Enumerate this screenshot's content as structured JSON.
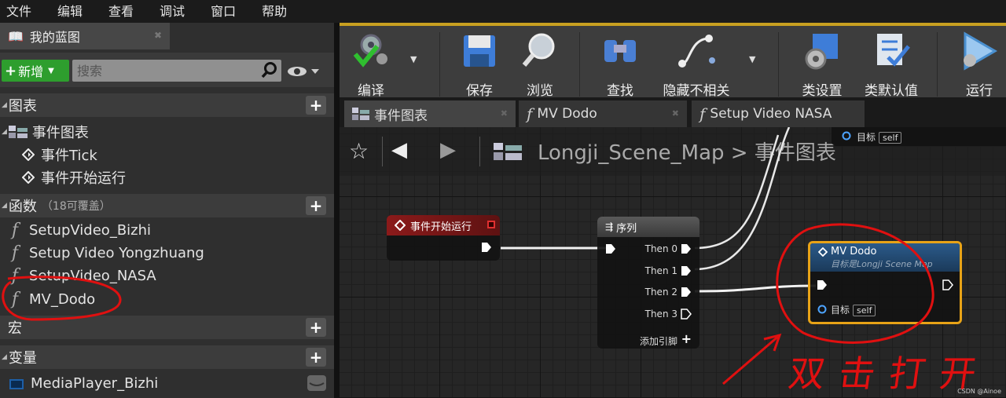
{
  "menu": [
    "文件",
    "编辑",
    "查看",
    "调试",
    "窗口",
    "帮助"
  ],
  "my_blueprint": {
    "tab_title": "我的蓝图",
    "add_label": "新增",
    "search_placeholder": "搜索",
    "sections": {
      "graphs": "图表",
      "functions": "函数",
      "functions_sub": "（18可覆盖）",
      "macros": "宏",
      "variables": "变量"
    },
    "event_graph": "事件图表",
    "events": [
      "事件Tick",
      "事件开始运行"
    ],
    "functions": [
      "SetupVideo_Bizhi",
      "Setup Video Yongzhuang",
      "SetupVideo_NASA",
      "MV_Dodo"
    ],
    "variables": [
      "MediaPlayer_Bizhi"
    ]
  },
  "toolbar": {
    "compile": "编译",
    "save": "保存",
    "browse": "浏览",
    "find": "查找",
    "hide_unrelated": "隐藏不相关",
    "class_settings": "类设置",
    "class_defaults": "类默认值",
    "run": "运行"
  },
  "doc_tabs": [
    "事件图表",
    "MV Dodo",
    "Setup Video NASA"
  ],
  "breadcrumb": {
    "map": "Longji_Scene_Map",
    "sep": ">",
    "graph": "事件图表"
  },
  "nodes": {
    "begin_play": {
      "title": "事件开始运行"
    },
    "sequence": {
      "title": "序列",
      "pins": [
        "Then 0",
        "Then 1",
        "Then 2",
        "Then 3"
      ],
      "add_pin": "添加引脚"
    },
    "mv_dodo": {
      "title": "MV Dodo",
      "subtitle": "目标是Longji Scene Map",
      "target_label": "目标",
      "target_value": "self"
    },
    "top_fragment": {
      "target_label": "目标",
      "target_value": "self"
    }
  },
  "annotation": "双击打开",
  "watermark": "CSDN @Ainoe",
  "colors": {
    "event_header": "#8b1a1a",
    "highlight_circle": "#e01010",
    "selected_node_border": "#e8a317",
    "toolbar_accent": "#c8a020"
  }
}
